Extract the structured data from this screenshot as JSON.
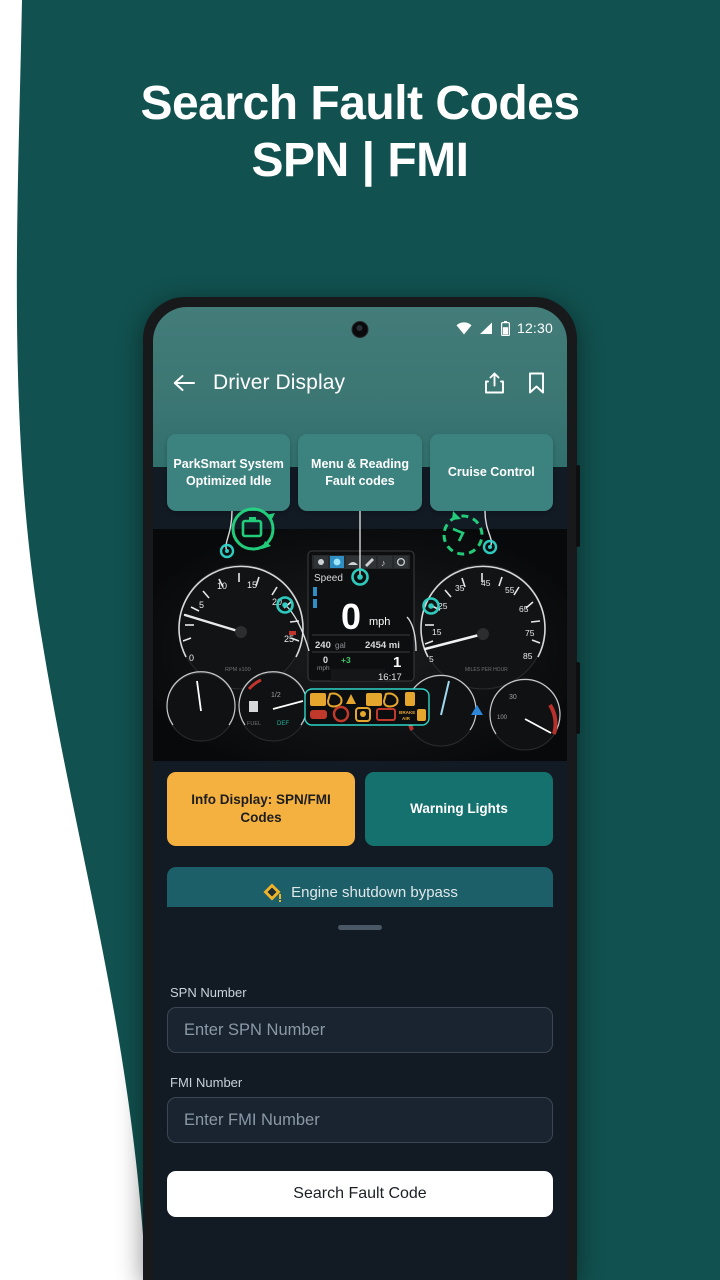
{
  "promo": {
    "headline_line1": "Search Fault Codes",
    "headline_line2": "SPN | FMI",
    "background_color": "#11514f",
    "accent_white": "#ffffff"
  },
  "phone": {
    "status_bar": {
      "time": "12:30",
      "icons": [
        "wifi-icon",
        "cellular-signal-icon",
        "battery-icon"
      ]
    },
    "app_bar": {
      "back_icon": "arrow-left-icon",
      "title": "Driver Display",
      "share_icon": "share-icon",
      "bookmark_icon": "bookmark-icon"
    },
    "chips": [
      {
        "label": "ParkSmart System Optimized Idle"
      },
      {
        "label": "Menu & Reading Fault codes"
      },
      {
        "label": "Cruise Control"
      }
    ],
    "dashboard": {
      "left_gauge": {
        "name": "tachometer",
        "unit": "RPM x100",
        "ticks": [
          "0",
          "5",
          "10",
          "15",
          "20",
          "25"
        ],
        "value": 0
      },
      "right_gauge": {
        "name": "speedometer",
        "unit": "mph",
        "ticks": [
          "5",
          "15",
          "25",
          "35",
          "45",
          "55",
          "65",
          "75",
          "85"
        ],
        "value": 0
      },
      "info_display": {
        "header_label": "Speed",
        "speed_value": "0",
        "speed_unit": "mph",
        "fuel": "240 gal",
        "odometer": "2454 mi",
        "set_speed": "0",
        "set_speed_unit": "mph",
        "offset": "+3",
        "gear": "1",
        "clock": "16:17",
        "menu_icons": [
          "settings-icon",
          "engine-icon",
          "road-icon",
          "wrench-icon",
          "music-icon",
          "phone-icon"
        ]
      },
      "warning_lights": {
        "row1_icons": [
          "engine-oil-icon",
          "check-engine-icon",
          "water-in-fuel-icon",
          "oil-pressure-icon",
          "coolant-icon",
          "battery-warning-icon"
        ],
        "row2_icons": [
          "brake-icon",
          "stop-engine-icon",
          "def-level-icon",
          "battery-icon",
          "brake-air-icon",
          "fuel-filter-icon"
        ],
        "brake_label": "BRAKE"
      },
      "markers": [
        {
          "name": "parksmart-marker",
          "icon": "engine-rotate-icon"
        },
        {
          "name": "menu-marker",
          "icon": "target-dot-icon"
        },
        {
          "name": "cruise-marker",
          "icon": "cruise-gauge-icon"
        },
        {
          "name": "info-display-marker",
          "icon": "target-dot-icon"
        },
        {
          "name": "warning-lights-marker",
          "icon": "target-dot-icon"
        }
      ]
    },
    "actions": [
      {
        "label": "Info Display: SPN/FMI Codes",
        "color": "#f4b13f",
        "style": "orange"
      },
      {
        "label": "Warning Lights",
        "color": "#15716e",
        "style": "teal"
      }
    ],
    "bypass_bar": {
      "icon": "warning-diamond-icon",
      "label": "Engine shutdown bypass"
    },
    "sheet": {
      "handle": "drag-handle",
      "spn_label": "SPN Number",
      "spn_placeholder": "Enter SPN Number",
      "spn_value": "",
      "fmi_label": "FMI Number",
      "fmi_placeholder": "Enter FMI Number",
      "fmi_value": "",
      "search_button": "Search Fault Code"
    }
  }
}
